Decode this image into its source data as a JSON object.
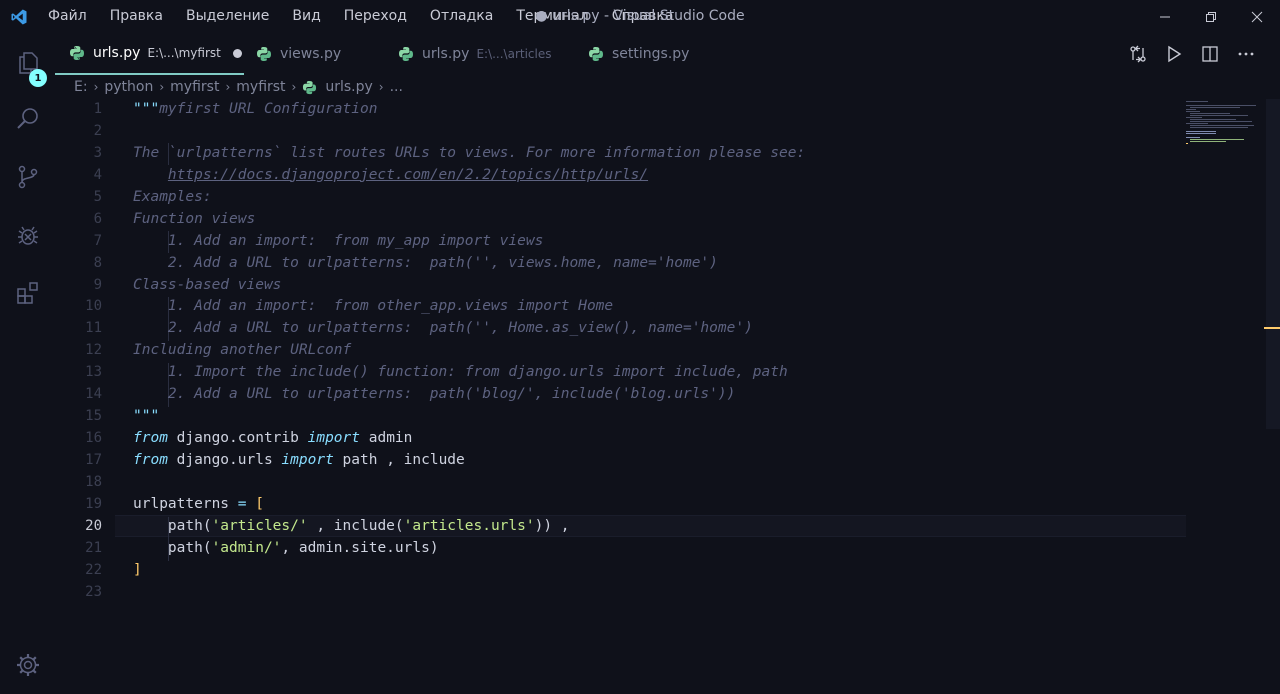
{
  "titlebar": {
    "menu": [
      "Файл",
      "Правка",
      "Выделение",
      "Вид",
      "Переход",
      "Отладка",
      "Терминал",
      "Справка"
    ],
    "title": "● urls.py - Visual Studio Code"
  },
  "activity": {
    "source_control_badge": "1"
  },
  "tabs": [
    {
      "name": "urls.py",
      "desc": "E:\\...\\myfirst",
      "active": true,
      "dirty": true
    },
    {
      "name": "views.py",
      "desc": "",
      "active": false
    },
    {
      "name": "urls.py",
      "desc": "E:\\...\\articles",
      "active": false
    },
    {
      "name": "settings.py",
      "desc": "",
      "active": false
    }
  ],
  "breadcrumb": [
    "E:",
    "python",
    "myfirst",
    "myfirst",
    "urls.py",
    "..."
  ],
  "editor": {
    "line_numbers": [
      "1",
      "2",
      "3",
      "4",
      "5",
      "6",
      "7",
      "8",
      "9",
      "10",
      "11",
      "12",
      "13",
      "14",
      "15",
      "16",
      "17",
      "18",
      "19",
      "20",
      "21",
      "22",
      "23"
    ],
    "current_line": "20",
    "code": {
      "l1_quote": "\"\"\"",
      "l1_text": "myfirst URL Configuration",
      "l3": "The `urlpatterns` list routes URLs to views. For more information please see:",
      "l4_url": "https://docs.djangoproject.com/en/2.2/topics/http/urls/",
      "l5": "Examples:",
      "l6": "Function views",
      "l7": "    1. Add an import:  from my_app import views",
      "l8": "    2. Add a URL to urlpatterns:  path('', views.home, name='home')",
      "l9": "Class-based views",
      "l10": "    1. Add an import:  from other_app.views import Home",
      "l11": "    2. Add a URL to urlpatterns:  path('', Home.as_view(), name='home')",
      "l12": "Including another URLconf",
      "l13": "    1. Import the include() function: from django.urls import include, path",
      "l14": "    2. Add a URL to urlpatterns:  path('blog/', include('blog.urls'))",
      "l15": "\"\"\"",
      "kw_from": "from",
      "kw_import": "import",
      "l16_mod": " django.contrib ",
      "l16_name": " admin",
      "l17_mod": " django.urls ",
      "l17_name": " path , include",
      "l19_var": "urlpatterns ",
      "l19_eq": "=",
      "l19_br": "[",
      "l20_fn": "    path(",
      "l20_s1": "'articles/'",
      "l20_mid": " , include(",
      "l20_s2": "'articles.urls'",
      "l20_end": ")) ,",
      "l21_fn": "    path(",
      "l21_s1": "'admin/'",
      "l21_mid": ", admin.site.urls)",
      "l22_br": "]"
    }
  },
  "colors": {
    "background": "#0f111a",
    "accent": "#80cbc4",
    "badge": "#84ffff",
    "string": "#c3e88d",
    "keyword": "#89ddff",
    "comment": "#5d6280"
  }
}
